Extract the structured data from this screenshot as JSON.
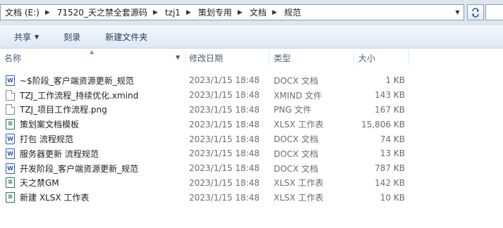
{
  "address": {
    "crumbs": [
      "文档 (E:)",
      "71520_天之禁全套源码",
      "tzj1",
      "策划专用",
      "文档",
      "规范"
    ]
  },
  "toolbar": {
    "share_label": "共享",
    "burn_label": "刻录",
    "new_folder_label": "新建文件夹"
  },
  "columns": {
    "name": "名称",
    "date": "修改日期",
    "type": "类型",
    "size": "大小"
  },
  "files": [
    {
      "name": "~$阶段_客户端资源更新_规范",
      "date": "2023/1/15 18:48",
      "type": "DOCX 文档",
      "size": "1 KB",
      "icon": "docx-file-icon"
    },
    {
      "name": "TZJ_工作流程_持续优化.xmind",
      "date": "2023/1/15 18:48",
      "type": "XMIND 文件",
      "size": "143 KB",
      "icon": "generic-file-icon"
    },
    {
      "name": "TZJ_项目工作流程.png",
      "date": "2023/1/15 18:48",
      "type": "PNG 文件",
      "size": "167 KB",
      "icon": "generic-file-icon"
    },
    {
      "name": "策划案文档模板",
      "date": "2023/1/15 18:48",
      "type": "XLSX 工作表",
      "size": "15,806 KB",
      "icon": "xlsx-file-icon"
    },
    {
      "name": "打包 流程规范",
      "date": "2023/1/15 18:48",
      "type": "DOCX 文档",
      "size": "74 KB",
      "icon": "docx-file-icon"
    },
    {
      "name": "服务器更新 流程规范",
      "date": "2023/1/15 18:48",
      "type": "DOCX 文档",
      "size": "13 KB",
      "icon": "docx-file-icon"
    },
    {
      "name": "开发阶段_客户端资源更新_规范",
      "date": "2023/1/15 18:48",
      "type": "DOCX 文档",
      "size": "787 KB",
      "icon": "docx-file-icon"
    },
    {
      "name": "天之禁GM",
      "date": "2023/1/15 18:48",
      "type": "XLSX 工作表",
      "size": "142 KB",
      "icon": "xlsx-file-icon"
    },
    {
      "name": "新建 XLSX 工作表",
      "date": "2023/1/15 18:48",
      "type": "XLSX 工作表",
      "size": "10 KB",
      "icon": "xlsx-file-icon"
    }
  ],
  "colors": {
    "docx_icon": "#2b5eb5",
    "xlsx_icon": "#217346",
    "toolbar_text": "#1e395b"
  }
}
